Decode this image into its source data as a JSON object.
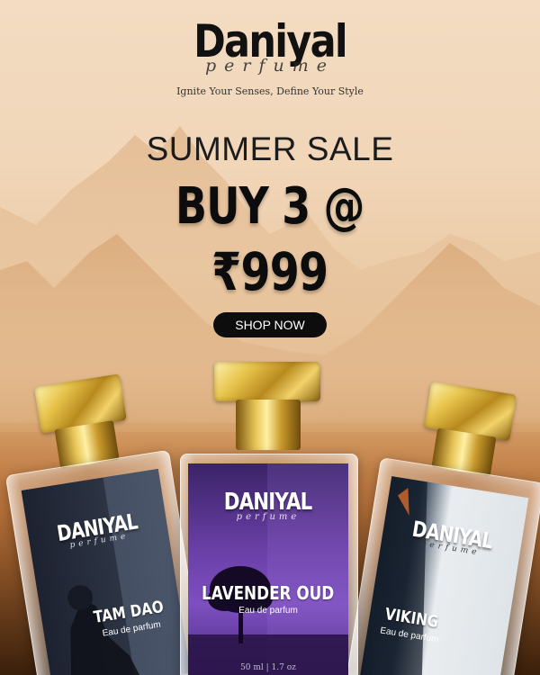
{
  "brand": {
    "name": "Daniyal",
    "sub": "perfume",
    "tagline": "Ignite Your Senses, Define Your Style"
  },
  "promo": {
    "title": "SUMMER SALE",
    "offer_line1": "BUY 3 @",
    "offer_line2": "₹999",
    "cta_label": "SHOP NOW"
  },
  "products": [
    {
      "brand": "DANIYAL",
      "sub": "perfume",
      "name": "TAM DAO",
      "type": "Eau de parfum",
      "label_color": "#2b3242"
    },
    {
      "brand": "DANIYAL",
      "sub": "perfume",
      "name": "LAVENDER OUD",
      "type": "Eau de parfum",
      "volume": "50 ml | 1.7 oz",
      "label_color": "#6a3fa6"
    },
    {
      "brand": "DANIYAL",
      "sub": "perfume",
      "name": "VIKING",
      "type": "Eau de parfum",
      "label_color": "#e9edf0"
    }
  ],
  "colors": {
    "sky": "#f1d6b8",
    "desert": "#c07c45",
    "button": "#0d0d0d",
    "gold": "#e8c54d"
  }
}
